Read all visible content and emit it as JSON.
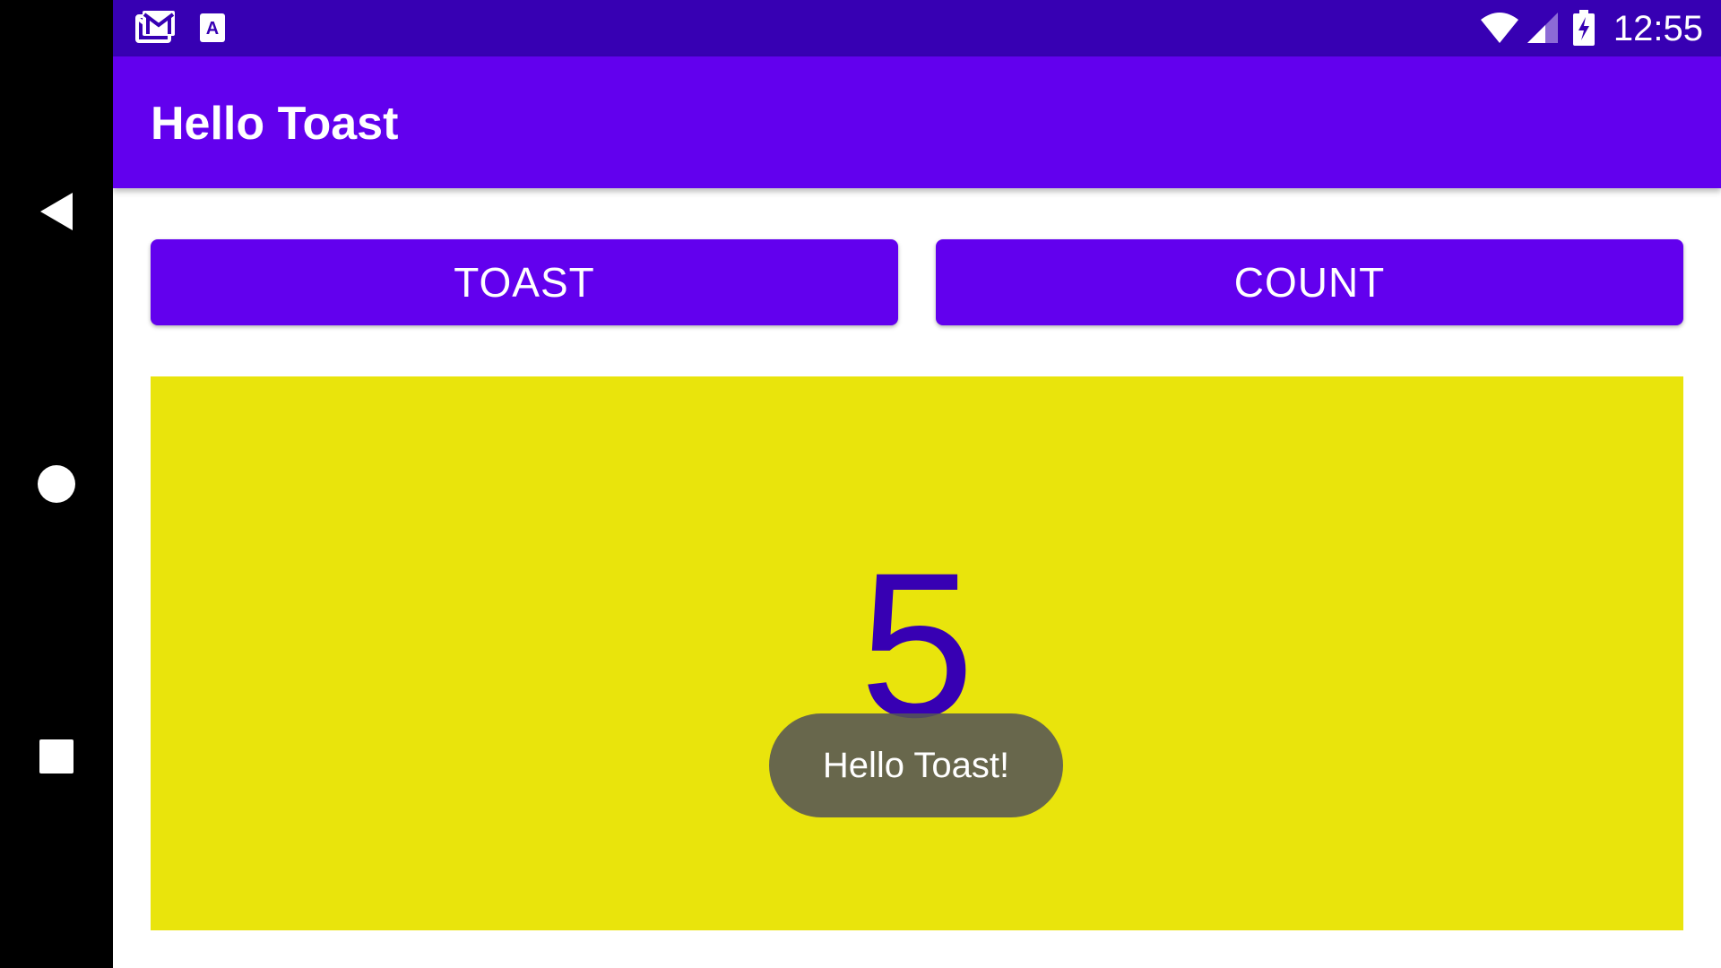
{
  "status_bar": {
    "time": "12:55",
    "left_icons": [
      "gmail-icon",
      "a-icon"
    ],
    "right_icons": [
      "wifi-icon",
      "signal-icon",
      "battery-charging-icon"
    ]
  },
  "app_bar": {
    "title": "Hello Toast"
  },
  "buttons": {
    "toast_label": "TOAST",
    "count_label": "COUNT"
  },
  "count": {
    "value": "5"
  },
  "toast": {
    "message": "Hello Toast!"
  },
  "colors": {
    "primary": "#6200ee",
    "primary_dark": "#3700b3",
    "count_background": "#e9e40c",
    "count_text": "#3700b3",
    "toast_background": "#555555"
  },
  "navigation": [
    "back-icon",
    "home-icon",
    "recents-icon"
  ]
}
